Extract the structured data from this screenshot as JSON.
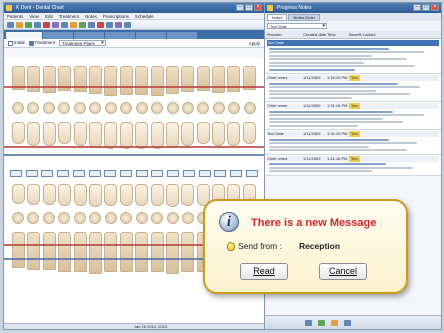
{
  "dental_window": {
    "title": "K Dent - Dental Chart",
    "menu": [
      "Patients",
      "View",
      "Edit",
      "Treatment",
      "Notes",
      "Prescriptions",
      "Schedule"
    ],
    "tabs": [
      "",
      "",
      "",
      "",
      "",
      ""
    ],
    "options": {
      "initial_label": "Initial",
      "treatment_label": "Treatment",
      "treatment_plans_value": "Treatment Plans",
      "apply_label": "Apply"
    },
    "status": "",
    "footer_date": "Jan 16 2014, 2013"
  },
  "notes_window": {
    "title": "Progress Notes",
    "tabs": [
      "Notes",
      "Notes Order"
    ],
    "filter_value": "Tool Date",
    "columns": [
      "Provider",
      "Created date",
      "Time",
      "Benefit Locked"
    ],
    "notes": [
      {
        "provider": "Tool Date",
        "date": "",
        "time": "",
        "locked": "",
        "selected": true
      },
      {
        "provider": "Chief omes",
        "date": "1/11/2009",
        "time": "1:16:19 PM",
        "locked": "Yes",
        "selected": false
      },
      {
        "provider": "Chief omes",
        "date": "1/11/2009",
        "time": "1:31:16 PM",
        "locked": "Yes",
        "selected": false
      },
      {
        "provider": "Tool Date",
        "date": "1/11/2009",
        "time": "1:31:19 PM",
        "locked": "Yes",
        "selected": false
      },
      {
        "provider": "Chief omes",
        "date": "1/11/2009",
        "time": "1:41:16 PM",
        "locked": "Yes",
        "selected": false
      }
    ]
  },
  "popup": {
    "title": "There is a new Message",
    "from_label": "Send from :",
    "from_value": "Reception",
    "read_button": "Read",
    "cancel_button": "Cancel",
    "icon": "info-icon"
  }
}
